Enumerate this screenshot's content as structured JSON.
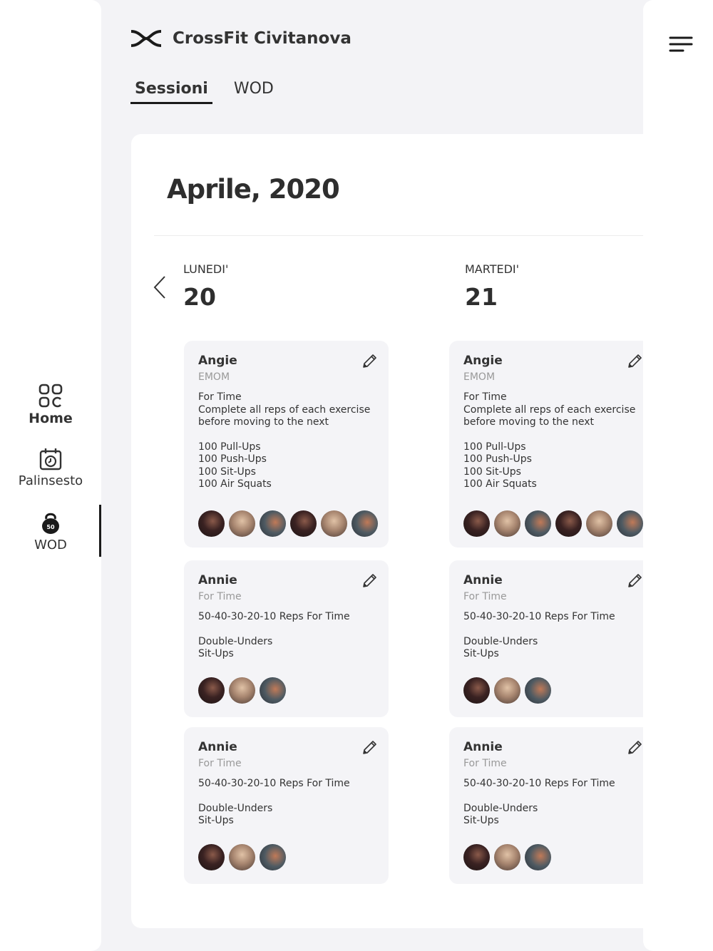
{
  "app": {
    "brand_name": "CrossFit Civitanova"
  },
  "nav": {
    "home": "Home",
    "schedule": "Palinsesto",
    "wod": "WOD",
    "wod_badge": "50"
  },
  "tabs": {
    "active": "Sessioni",
    "inactive": "WOD"
  },
  "calendar": {
    "month": "Aprile, 2020",
    "days": [
      {
        "name": "LUNEDI'",
        "number": "20"
      },
      {
        "name": "MARTEDI'",
        "number": "21"
      }
    ]
  },
  "sessions": {
    "angie": {
      "title": "Angie",
      "type": "EMOM",
      "desc_1": "For Time",
      "desc_2": "Complete all reps of each exercise",
      "desc_3": "before moving to the next",
      "ex_1": "100 Pull-Ups",
      "ex_2": "100 Push-Ups",
      "ex_3": "100 Sit-Ups",
      "ex_4": "100 Air Squats"
    },
    "annie": {
      "title": "Annie",
      "type": "For Time",
      "desc_1": "50-40-30-20-10 Reps For Time",
      "ex_1": "Double-Unders",
      "ex_2": "Sit-Ups"
    }
  }
}
